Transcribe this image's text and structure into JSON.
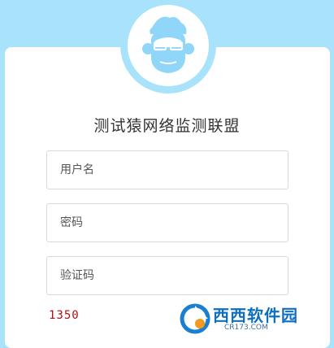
{
  "brand": {
    "logo_icon": "monkey-with-glasses-icon",
    "accent_color": "#a9e3fb"
  },
  "title": "测试猿网络监测联盟",
  "form": {
    "username_placeholder": "用户名",
    "password_placeholder": "密码",
    "captcha_placeholder": "验证码",
    "captcha_code": "1350"
  },
  "watermark": {
    "text": "西西软件园",
    "sub": "CR173.COM"
  }
}
